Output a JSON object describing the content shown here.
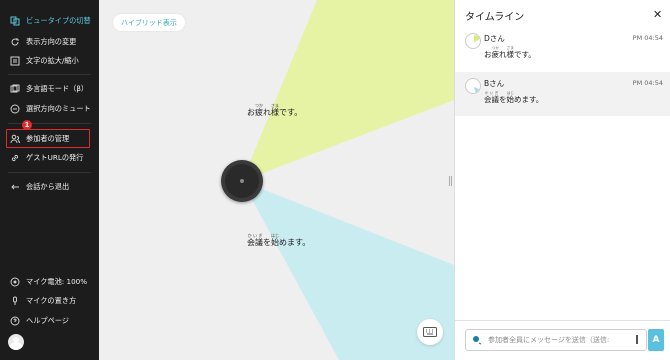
{
  "sidebar": {
    "items": [
      {
        "label": "ビュータイプの切替",
        "icon": "view-switch-icon",
        "active": true
      },
      {
        "label": "表示方向の変更",
        "icon": "rotate-icon"
      },
      {
        "label": "文字の拡大/縮小",
        "icon": "text-size-icon"
      },
      {
        "label": "多言語モード（β）",
        "icon": "language-icon"
      },
      {
        "label": "選択方向のミュート",
        "icon": "mute-icon"
      },
      {
        "label": "参加者の管理",
        "icon": "participants-icon"
      },
      {
        "label": "ゲストURLの発行",
        "icon": "link-icon"
      },
      {
        "label": "会話から退出",
        "icon": "exit-icon"
      }
    ],
    "bottom": [
      {
        "label": "マイク電池: 100%",
        "icon": "battery-icon"
      },
      {
        "label": "マイクの置き方",
        "icon": "mic-icon"
      },
      {
        "label": "ヘルプページ",
        "icon": "help-icon"
      }
    ],
    "badge": "1"
  },
  "center": {
    "hybrid_label": "ハイブリッド表示",
    "bubble1": {
      "base1": "お",
      "ruby1": "つか",
      "base2": "疲",
      "base3": "れ",
      "ruby3": "さま",
      "base4": "様",
      "tail": "です。"
    },
    "bubble2": {
      "ruby1": "かいぎ",
      "base1": "会議",
      "mid": "を",
      "ruby2": "はじ",
      "base2": "始",
      "tail": "めます。"
    },
    "colors": {
      "beam_yellow": "#e6f2a4",
      "beam_blue": "#c8ecf0"
    }
  },
  "timeline": {
    "title": "タイムライン",
    "close": "✕",
    "messages": [
      {
        "name": "Dさん",
        "time": "PM 04:54",
        "text_a": "お",
        "ruby_a": "つか",
        "base_a": "疲",
        "mid": "れ",
        "ruby_b": "さま",
        "base_b": "様",
        "tail": "です。"
      },
      {
        "name": "Bさん",
        "time": "PM 04:54",
        "ruby_a": "かいぎ",
        "base_a": "会議",
        "mid": "を",
        "ruby_b": "はじ",
        "base_b": "始",
        "tail": "めます。"
      }
    ],
    "input_placeholder": "参加者全員にメッセージを送信（送信:",
    "send_label": "A"
  }
}
